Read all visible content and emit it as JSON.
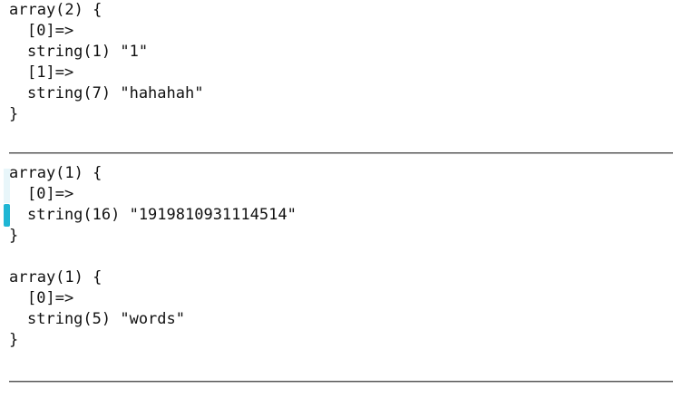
{
  "dumps": [
    {
      "header": "array(2) {",
      "entries": [
        {
          "key": "[0]=>",
          "value": "string(1) \"1\""
        },
        {
          "key": "[1]=>",
          "value": "string(7) \"hahahah\""
        }
      ],
      "close": "}"
    },
    {
      "header": "array(1) {",
      "entries": [
        {
          "key": "[0]=>",
          "value": "string(16) \"1919810931114514\""
        }
      ],
      "close": "}"
    },
    {
      "header": "array(1) {",
      "entries": [
        {
          "key": "[0]=>",
          "value": "string(5) \"words\""
        }
      ],
      "close": "}"
    }
  ],
  "colors": {
    "text": "#111111",
    "rule": "#555555",
    "cursor": "#1fb6d4"
  }
}
